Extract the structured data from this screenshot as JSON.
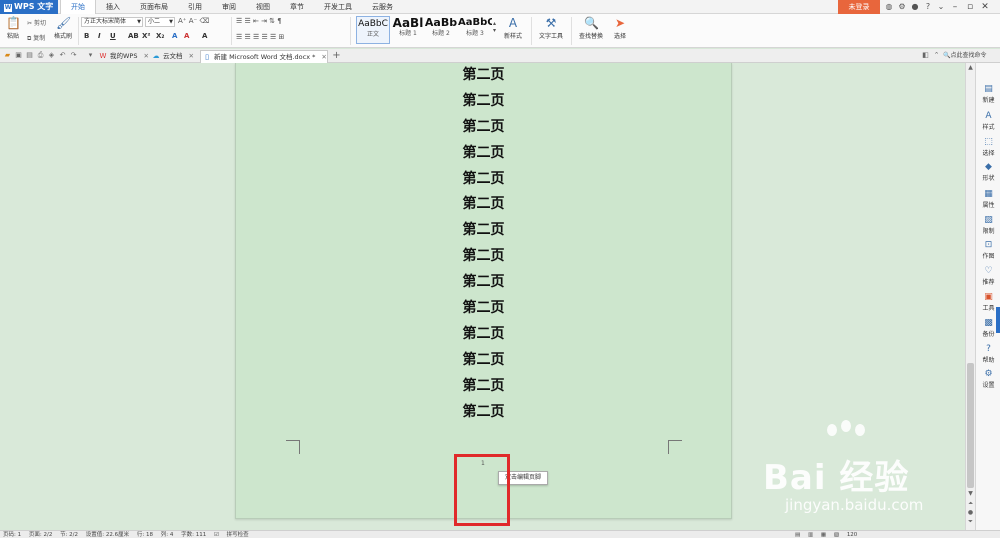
{
  "title_bar": {
    "app_name": "WPS 文字",
    "menu_tabs": [
      "开始",
      "插入",
      "页面布局",
      "引用",
      "审阅",
      "视图",
      "章节",
      "开发工具",
      "云服务"
    ],
    "active_tab": "开始",
    "login_label": "未登录"
  },
  "ribbon": {
    "paste": "粘贴",
    "cut": "剪切",
    "copy": "复制",
    "format_painter": "格式刷",
    "font_name": "方正大标宋简体",
    "font_size": "小二",
    "styles": [
      {
        "sample": "AaBbC",
        "name": "正文"
      },
      {
        "sample": "AaBl",
        "name": "标题 1"
      },
      {
        "sample": "AaBb",
        "name": "标题 2"
      },
      {
        "sample": "AaBbC",
        "name": "标题 3"
      }
    ],
    "new_style": "新样式",
    "text_tools": "文字工具",
    "find_replace": "查找替换",
    "select": "选择"
  },
  "doc_tabs": {
    "tabs": [
      {
        "label": "我的WPS"
      },
      {
        "label": "云文档"
      },
      {
        "label": "新建 Microsoft Word 文档.docx *"
      }
    ],
    "search_command": "点此查找命令"
  },
  "document": {
    "lines": [
      "第二页",
      "第二页",
      "第二页",
      "第二页",
      "第二页",
      "第二页",
      "第二页",
      "第二页",
      "第二页",
      "第二页",
      "第二页",
      "第二页",
      "第二页",
      "第二页"
    ],
    "page_number": "1",
    "footer_tip": "双击编辑页脚"
  },
  "task_pane": {
    "items": [
      "新建",
      "样式",
      "选择",
      "形状",
      "属性",
      "限制",
      "作图",
      "推荐",
      "工具",
      "备份",
      "帮助",
      "设置"
    ]
  },
  "status_bar": {
    "page_no": "页码: 1",
    "pages": "页面: 2/2",
    "section": "节: 2/2",
    "setting": "设置值: 22.6厘米",
    "row": "行: 18",
    "col": "列: 4",
    "words": "字数: 111",
    "spell": "拼写检查",
    "zoom": "120"
  },
  "watermark": {
    "logo_text": "Bai 经验",
    "url": "jingyan.baidu.com"
  }
}
